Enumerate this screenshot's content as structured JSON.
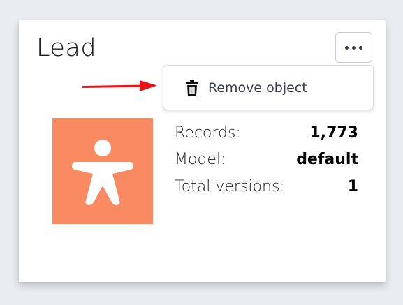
{
  "card": {
    "title": "Lead",
    "menu_button_icon": "more-horizontal-icon",
    "dropdown": {
      "items": [
        {
          "icon": "trash-icon",
          "label": "Remove object"
        }
      ]
    },
    "annotation_arrow_color": "#e8141b",
    "avatar": {
      "icon": "person-star-icon",
      "background_color": "#fa8a62"
    },
    "stats": [
      {
        "label": "Records:",
        "value": "1,773"
      },
      {
        "label": "Model:",
        "value": "default"
      },
      {
        "label": "Total versions:",
        "value": "1"
      }
    ]
  }
}
